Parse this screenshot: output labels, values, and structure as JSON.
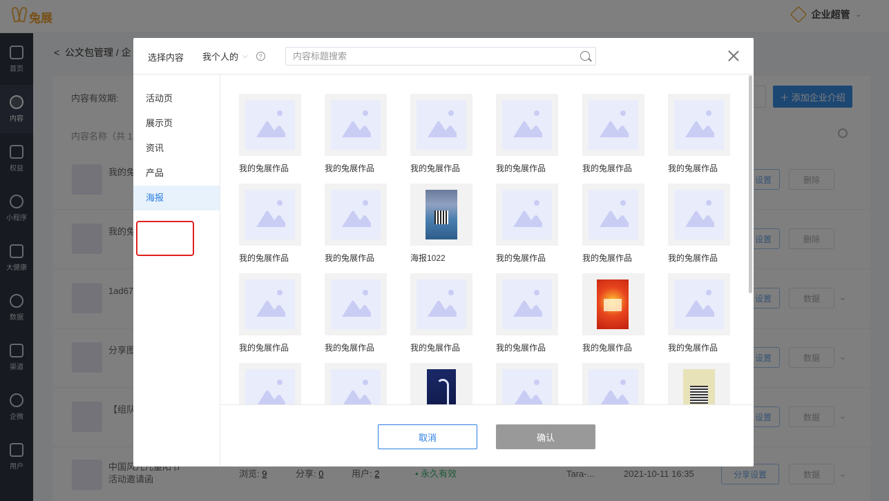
{
  "app": {
    "logo_text": "兔展",
    "user_role": "企业超管"
  },
  "sidebar": {
    "items": [
      {
        "label": "首页",
        "icon": "home-icon"
      },
      {
        "label": "内容",
        "icon": "document-icon",
        "active": true
      },
      {
        "label": "权益",
        "icon": "badge-icon"
      },
      {
        "label": "小程序",
        "icon": "miniprogram-icon"
      },
      {
        "label": "大健康",
        "icon": "health-icon"
      },
      {
        "label": "数据",
        "icon": "pie-chart-icon"
      },
      {
        "label": "渠道",
        "icon": "send-icon"
      },
      {
        "label": "企微",
        "icon": "chat-icon"
      },
      {
        "label": "用户",
        "icon": "user-icon"
      }
    ]
  },
  "page": {
    "breadcrumb": "公文包管理 / 企",
    "validity_label": "内容有效期:",
    "add_button": "添加企业介绍",
    "list_header": "内容名称（共 12",
    "rows": [
      {
        "title": "我的兔",
        "btn1": "设置",
        "btn2": "删除"
      },
      {
        "title": "我的兔",
        "btn1": "设置",
        "btn2": "删除"
      },
      {
        "title": "1ad67 00a10",
        "btn1": "设置",
        "btn2": "数据"
      },
      {
        "title": "分享图",
        "btn1": "设置",
        "btn2": "数据"
      },
      {
        "title": "【组队 奖】旅",
        "btn1": "设置",
        "btn2": "数据"
      }
    ],
    "last_row": {
      "title_line1": "中国风儿儿童阳节",
      "title_line2": "活动邀请函",
      "views_label": "浏览:",
      "views": "9",
      "shares_label": "分享:",
      "shares": "0",
      "users_label": "用户:",
      "users": "2",
      "validity": "永久有效",
      "owner": "Tara-...",
      "date": "2021-10-11 16:35",
      "share_setting": "分享设置",
      "data_btn": "数据"
    }
  },
  "modal": {
    "title": "选择内容",
    "scope": "我个人的",
    "help": "?",
    "search_placeholder": "内容标题搜索",
    "categories": [
      "活动页",
      "展示页",
      "资讯",
      "产品",
      "海报"
    ],
    "active_category": "海报",
    "items": [
      {
        "label": "我的兔展作品",
        "type": "placeholder"
      },
      {
        "label": "我的兔展作品",
        "type": "placeholder"
      },
      {
        "label": "我的兔展作品",
        "type": "placeholder"
      },
      {
        "label": "我的兔展作品",
        "type": "placeholder"
      },
      {
        "label": "我的兔展作品",
        "type": "placeholder"
      },
      {
        "label": "我的兔展作品",
        "type": "placeholder"
      },
      {
        "label": "我的兔展作品",
        "type": "placeholder"
      },
      {
        "label": "我的兔展作品",
        "type": "placeholder"
      },
      {
        "label": "海报1022",
        "type": "laptop"
      },
      {
        "label": "我的兔展作品",
        "type": "placeholder"
      },
      {
        "label": "我的兔展作品",
        "type": "placeholder"
      },
      {
        "label": "我的兔展作品",
        "type": "placeholder"
      },
      {
        "label": "我的兔展作品",
        "type": "placeholder"
      },
      {
        "label": "我的兔展作品",
        "type": "placeholder"
      },
      {
        "label": "我的兔展作品",
        "type": "placeholder"
      },
      {
        "label": "我的兔展作品",
        "type": "placeholder"
      },
      {
        "label": "我的兔展作品",
        "type": "red"
      },
      {
        "label": "我的兔展作品",
        "type": "placeholder"
      },
      {
        "label": "",
        "type": "placeholder"
      },
      {
        "label": "",
        "type": "placeholder"
      },
      {
        "label": "",
        "type": "dark"
      },
      {
        "label": "",
        "type": "placeholder"
      },
      {
        "label": "",
        "type": "placeholder"
      },
      {
        "label": "",
        "type": "qr"
      }
    ],
    "cancel_label": "取消",
    "confirm_label": "确认"
  }
}
